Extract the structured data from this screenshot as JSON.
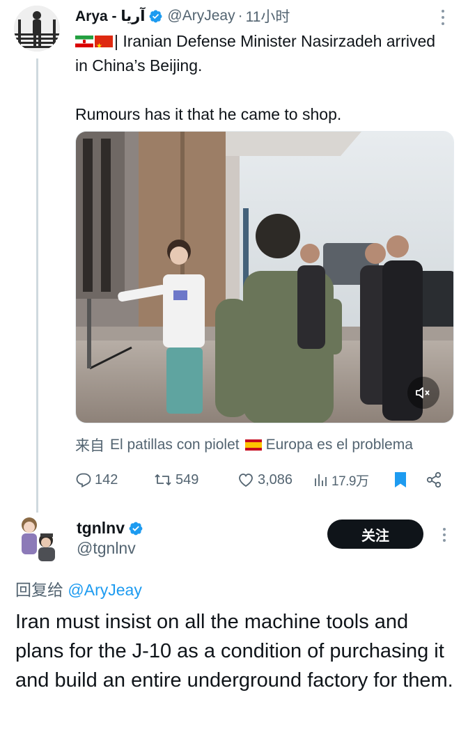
{
  "tweet1": {
    "display_name": "Arya - آریا",
    "handle": "@AryJeay",
    "separator": "·",
    "time": "11小时",
    "text_line1": "| Iranian Defense Minister Nasirzadeh arrived in China’s Beijing.",
    "text_line2": "Rumours has it that he came to shop.",
    "source_prefix": "来自",
    "source_name": "El patillas con piolet",
    "source_suffix": "Europa es el problema",
    "replies": "142",
    "retweets": "549",
    "likes": "3,086",
    "views": "17.9万"
  },
  "tweet2": {
    "display_name": "tgnlnv",
    "handle": "@tgnlnv",
    "follow_label": "关注",
    "reply_prefix": "回复给",
    "reply_mention": "@AryJeay",
    "text": "Iran must insist on all the machine tools and plans for the J-10 as a condition of purchasing it and build an entire underground factory for them."
  },
  "icons": {
    "verified": "verified-badge-icon",
    "reply": "reply-icon",
    "retweet": "retweet-icon",
    "like": "heart-icon",
    "views": "views-chart-icon",
    "bookmark": "bookmark-icon",
    "share": "share-icon",
    "mute": "mute-icon",
    "more": "more-vertical-icon"
  },
  "colors": {
    "text_primary": "#0f1419",
    "text_secondary": "#536471",
    "link": "#1d9bf0",
    "verified": "#1d9bf0",
    "bookmark_active": "#1d9bf0",
    "follow_bg": "#0f1419"
  }
}
